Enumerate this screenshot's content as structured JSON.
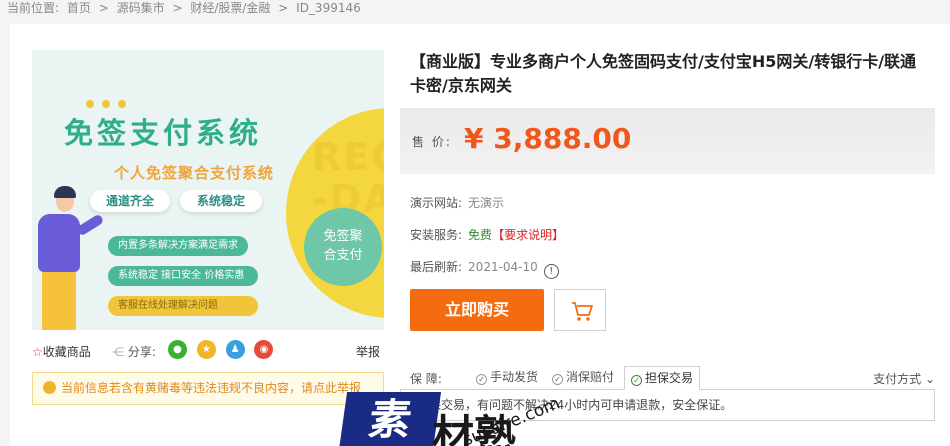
{
  "breadcrumb": {
    "prefix": "当前位置:",
    "items": [
      "首页",
      "源码集市",
      "财经/股票/金融",
      "ID_399146"
    ],
    "separator": ">"
  },
  "product_image": {
    "headline": "免签支付系统",
    "subline": "个人免签聚合支付系统",
    "pill_1": "通道齐全",
    "pill_2": "系统稳定",
    "bar_1": "内置多条解决方案满足需求",
    "bar_2": "系统稳定 接口安全 价格实惠",
    "bar_3": "客服在线处理解决问题",
    "circle_badge": "免签聚\n合支付",
    "bg_text": "REC\n-DA"
  },
  "image_footer": {
    "fav_star": "☆",
    "fav_label": "收藏商品",
    "share_label": "分享:",
    "share_icons": [
      "wechat-icon",
      "qzone-icon",
      "qq-icon",
      "weibo-icon"
    ],
    "report_label": "举报"
  },
  "notice": {
    "text": "当前信息若含有黄赌毒等违法违规不良内容，请点此举报"
  },
  "product": {
    "title": "【商业版】专业多商户个人免签固码支付/支付宝H5网关/转银行卡/联通卡密/京东网关",
    "price_label": "售 价:",
    "price": "¥ 3,888.00",
    "demo_label": "演示网站:",
    "demo_value": "无演示",
    "install_label": "安装服务:",
    "install_free": "免费",
    "install_req": "【要求说明】",
    "refresh_label": "最后刷新:",
    "refresh_date": "2021-04-10",
    "refresh_icon_glyph": "!",
    "buy_label": "立即购买"
  },
  "guarantee": {
    "label": "保  障:",
    "tabs": [
      "手动发货",
      "消保赔付",
      "担保交易"
    ],
    "active_tab": "担保交易",
    "pay_method": "支付方式",
    "description": "担保交易，有问题不解决24小时内可申请退款，安全保证。"
  },
  "watermark": {
    "logo": "素",
    "text": "材熟",
    "url": "sucaire.com"
  },
  "colors": {
    "accent": "#f36d10",
    "price": "#f1571d",
    "title_green": "#2fae8a",
    "watermark_blue": "#1a2b86"
  }
}
